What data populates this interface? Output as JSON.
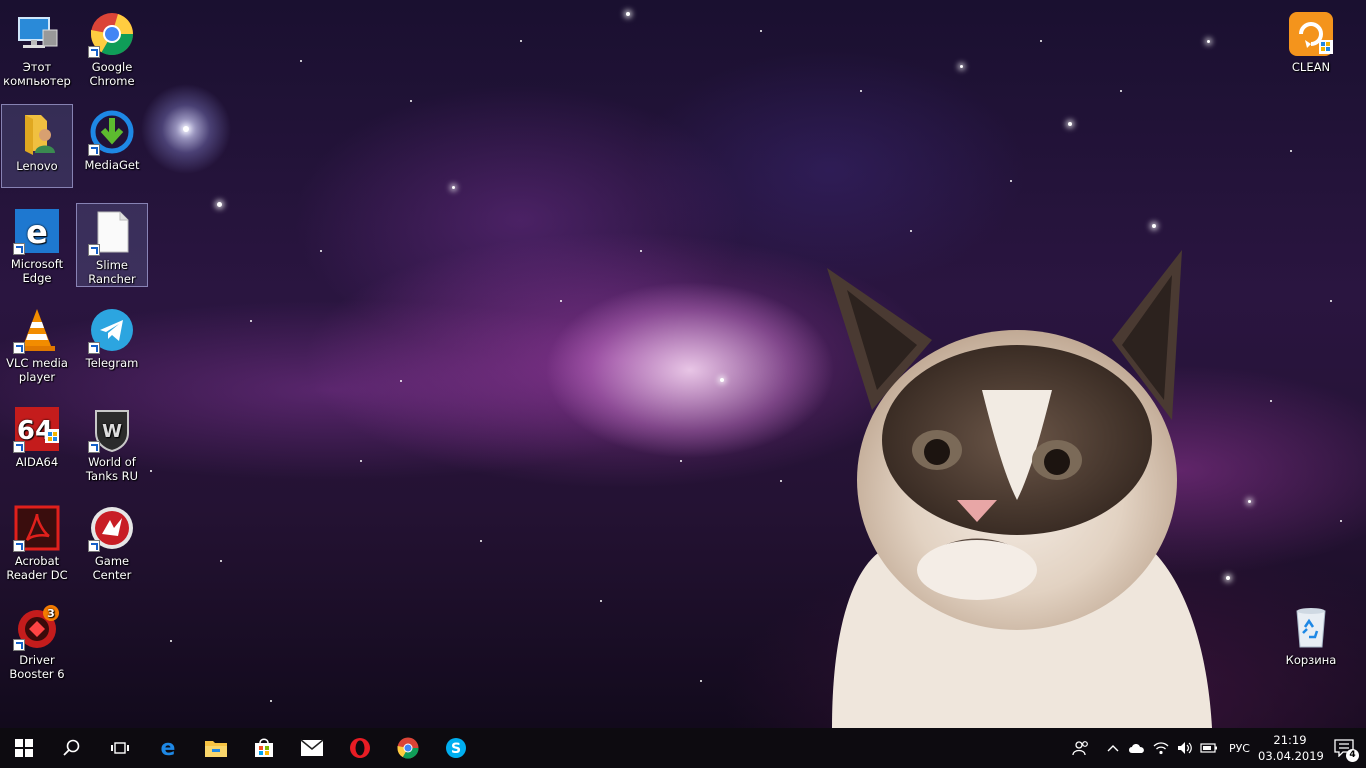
{
  "desktop": {
    "icons_left": [
      {
        "label": "Этот компьютер",
        "icon": "computer-icon"
      },
      {
        "label": "Google Chrome",
        "icon": "chrome-icon"
      },
      {
        "label": "Lenovo",
        "icon": "user-folder-icon"
      },
      {
        "label": "MediaGet",
        "icon": "mediaget-icon"
      },
      {
        "label": "Microsoft Edge",
        "icon": "edge-icon"
      },
      {
        "label": "Slime Rancher",
        "icon": "blank-file-icon"
      },
      {
        "label": "VLC media player",
        "icon": "vlc-icon"
      },
      {
        "label": "Telegram",
        "icon": "telegram-icon"
      },
      {
        "label": "AIDA64",
        "icon": "aida64-icon"
      },
      {
        "label": "World of Tanks RU",
        "icon": "world-of-tanks-icon"
      },
      {
        "label": "Acrobat Reader DC",
        "icon": "acrobat-icon"
      },
      {
        "label": "Game Center",
        "icon": "game-center-icon"
      },
      {
        "label": "Driver Booster 6",
        "icon": "driver-booster-icon",
        "badge": "3"
      }
    ],
    "icon_clean": {
      "label": "CLEAN",
      "icon": "clean-icon"
    },
    "icon_recycle": {
      "label": "Корзина",
      "icon": "recycle-bin-icon"
    }
  },
  "taskbar": {
    "pinned": [
      "start-icon",
      "search-icon",
      "task-view-icon",
      "edge-icon",
      "file-explorer-icon",
      "store-icon",
      "mail-icon",
      "opera-icon",
      "chrome-icon",
      "skype-icon"
    ],
    "tray": {
      "language": "РУС",
      "time": "21:19",
      "date": "03.04.2019",
      "notification_count": "4"
    }
  },
  "colors": {
    "taskbar_bg": "#0d0b10",
    "accent_blue": "#1e88e5",
    "wallpaper_purple": "#a040b0"
  }
}
